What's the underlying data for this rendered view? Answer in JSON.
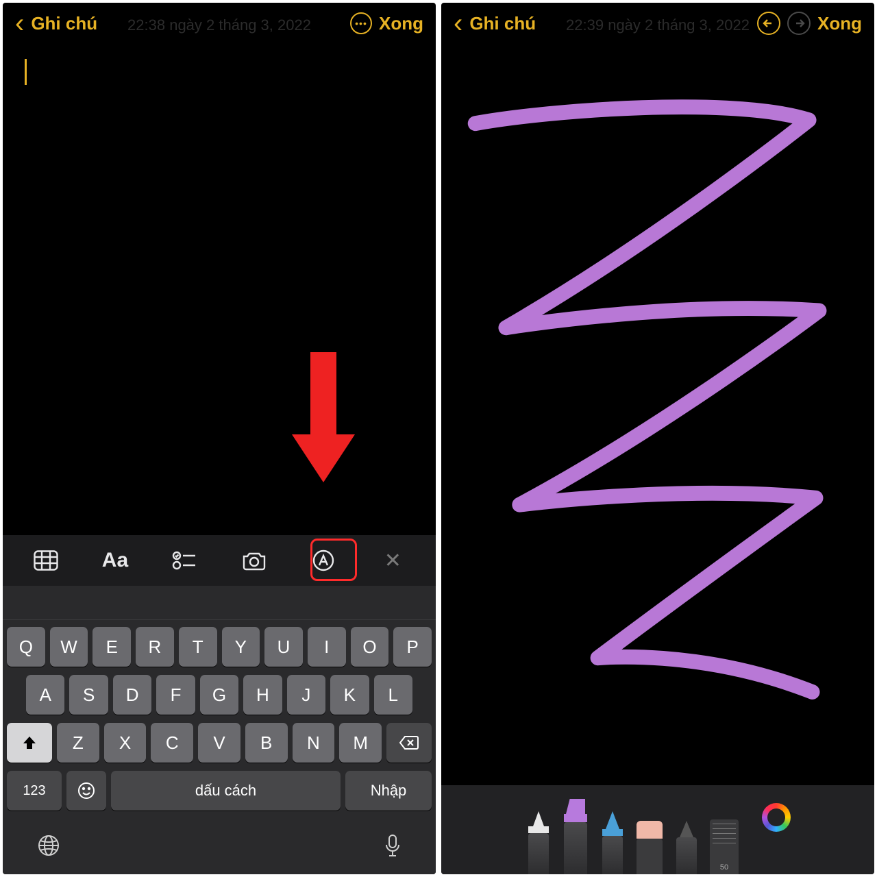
{
  "left": {
    "back_label": "Ghi chú",
    "done_label": "Xong",
    "timestamp": "22:38 ngày 2 tháng 3, 2022",
    "more_icon": "more-circle-icon",
    "fmt_icons": [
      "table-icon",
      "text-format-icon",
      "checklist-icon",
      "camera-icon",
      "markup-icon",
      "close-icon"
    ],
    "text_format_label": "Aa",
    "kb_rows": [
      [
        "Q",
        "W",
        "E",
        "R",
        "T",
        "Y",
        "U",
        "I",
        "O",
        "P"
      ],
      [
        "A",
        "S",
        "D",
        "F",
        "G",
        "H",
        "J",
        "K",
        "L"
      ],
      [
        "Z",
        "X",
        "C",
        "V",
        "B",
        "N",
        "M"
      ]
    ],
    "kb_123": "123",
    "kb_space": "dấu cách",
    "kb_return": "Nhập",
    "globe_icon": "globe-icon",
    "mic_icon": "mic-icon"
  },
  "right": {
    "back_label": "Ghi chú",
    "done_label": "Xong",
    "timestamp": "22:39 ngày 2 tháng 3, 2022",
    "undo_icon": "undo-icon",
    "redo_icon": "redo-icon",
    "tools": [
      "pen",
      "marker",
      "pencil",
      "eraser",
      "lasso",
      "ruler"
    ],
    "ruler_label": "50",
    "color_icon": "color-picker-icon",
    "stroke_color": "#b878d6"
  }
}
